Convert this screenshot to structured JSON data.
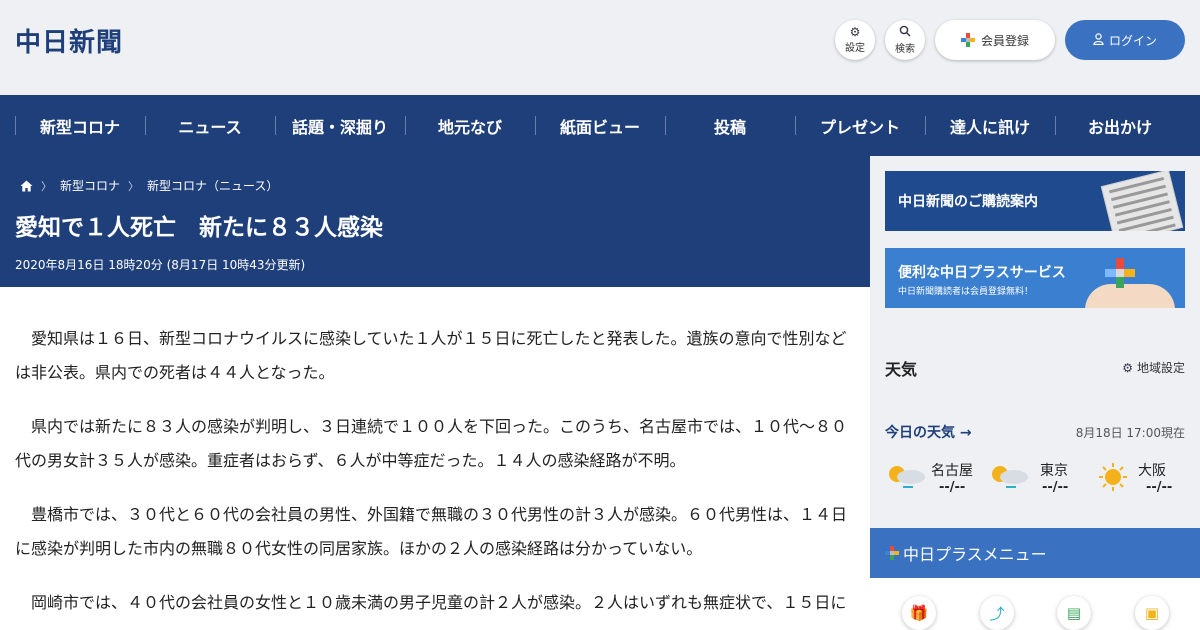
{
  "header": {
    "logo": "中日新聞",
    "settings_label": "設定",
    "search_label": "検索",
    "register_label": "会員登録",
    "login_label": "ログイン"
  },
  "nav": {
    "items": [
      {
        "label": "新型コロナ"
      },
      {
        "label": "ニュース"
      },
      {
        "label": "話題・深掘り"
      },
      {
        "label": "地元なび"
      },
      {
        "label": "紙面ビュー"
      },
      {
        "label": "投稿"
      },
      {
        "label": "プレゼント"
      },
      {
        "label": "達人に訊け"
      },
      {
        "label": "お出かけ"
      }
    ]
  },
  "breadcrumb": {
    "items": [
      "新型コロナ",
      "新型コロナ（ニュース）"
    ]
  },
  "article": {
    "title": "愛知で１人死亡　新たに８３人感染",
    "date": "2020年8月16日 18時20分 (8月17日 10時43分更新)",
    "paragraphs": [
      "愛知県は１６日、新型コロナウイルスに感染していた１人が１５日に死亡したと発表した。遺族の意向で性別などは非公表。県内での死者は４４人となった。",
      "県内では新たに８３人の感染が判明し、３日連続で１００人を下回った。このうち、名古屋市では、１０代～８０代の男女計３５人が感染。重症者はおらず、６人が中等症だった。１４人の感染経路が不明。",
      "豊橋市では、３０代と６０代の会社員の男性、外国籍で無職の３０代男性の計３人が感染。６０代男性は、１４日に感染が判明した市内の無職８０代女性の同居家族。ほかの２人の感染経路は分かっていない。",
      "岡崎市では、４０代の会社員の女性と１０歳未満の男子児童の計２人が感染。２人はいずれも無症状で、１５日に"
    ]
  },
  "sidebar": {
    "banner1": "中日新聞のご購読案内",
    "banner2_title": "便利な中日プラスサービス",
    "banner2_sub": "中日新聞購読者は会員登録無料！",
    "weather_title": "天気",
    "region_label": "地域設定",
    "today_label": "今日の天気 →",
    "as_of": "8月18日 17:00現在",
    "cities": [
      {
        "name": "名古屋",
        "temp": "--/--",
        "icon": "sun-cloud-rain-icon"
      },
      {
        "name": "東京",
        "temp": "--/--",
        "icon": "sun-cloud-rain-icon"
      },
      {
        "name": "大阪",
        "temp": "--/--",
        "icon": "sun-icon"
      }
    ],
    "plus_menu_label": "中日プラスメニュー"
  },
  "colors": {
    "navy": "#1e3f7a",
    "accent_blue": "#3a71c1",
    "panel_bg": "#eef0f4"
  }
}
